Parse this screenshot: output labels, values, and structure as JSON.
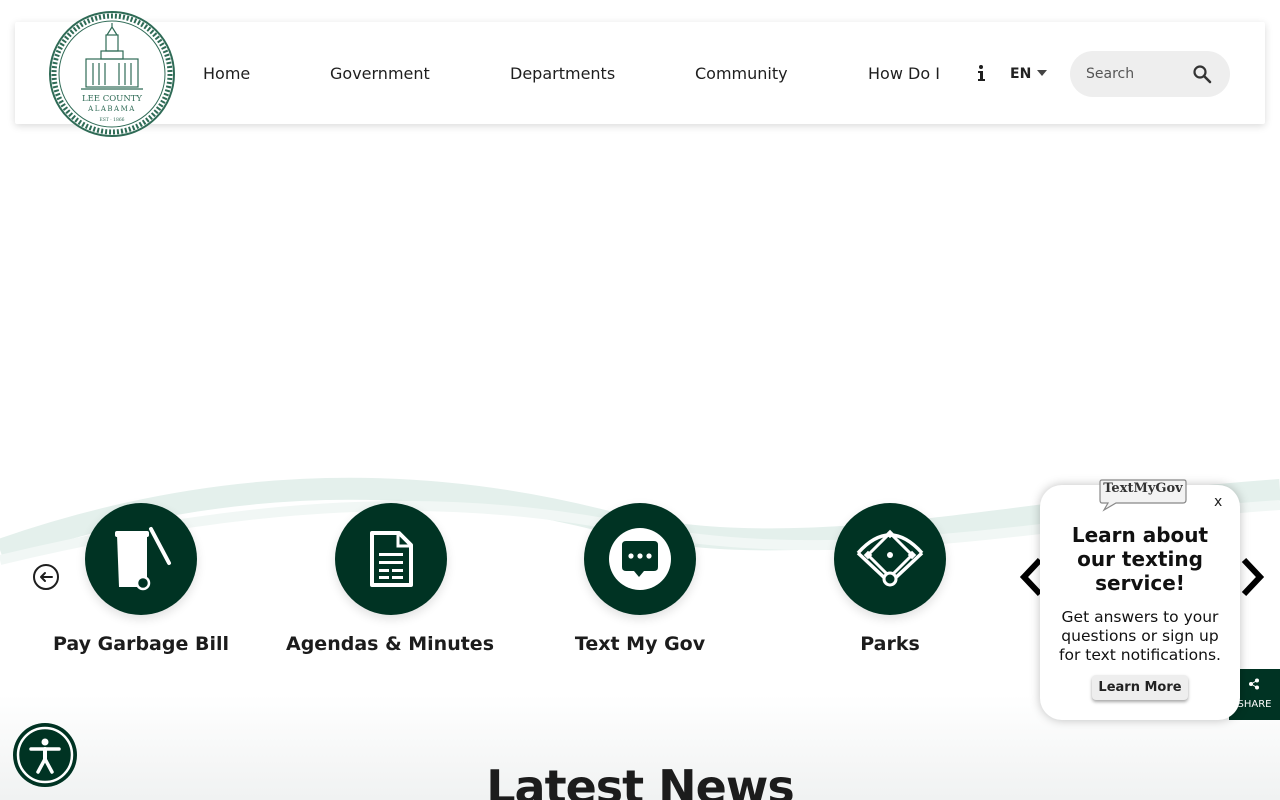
{
  "header": {
    "nav": [
      "Home",
      "Government",
      "Departments",
      "Community",
      "How Do I"
    ],
    "language": "EN",
    "search_placeholder": "Search",
    "logo": {
      "line1": "LEE COUNTY",
      "line2": "ALABAMA",
      "line3": "EST · 1866"
    }
  },
  "quick_links": [
    {
      "label": "Pay Garbage Bill",
      "icon": "garbage-can-icon"
    },
    {
      "label": "Agendas & Minutes",
      "icon": "document-icon"
    },
    {
      "label": "Text My Gov",
      "icon": "chat-bubble-icon"
    },
    {
      "label": "Parks",
      "icon": "baseball-diamond-icon"
    }
  ],
  "popup": {
    "brand": "TextMyGov",
    "close": "x",
    "title": "Learn about our texting service!",
    "description": "Get answers to your questions or sign up for text notifications.",
    "button": "Learn More"
  },
  "share": {
    "label": "SHARE"
  },
  "news": {
    "title": "Latest News"
  },
  "colors": {
    "primary_green": "#003323",
    "text": "#1e1e1e",
    "search_bg": "#eeeeee"
  }
}
